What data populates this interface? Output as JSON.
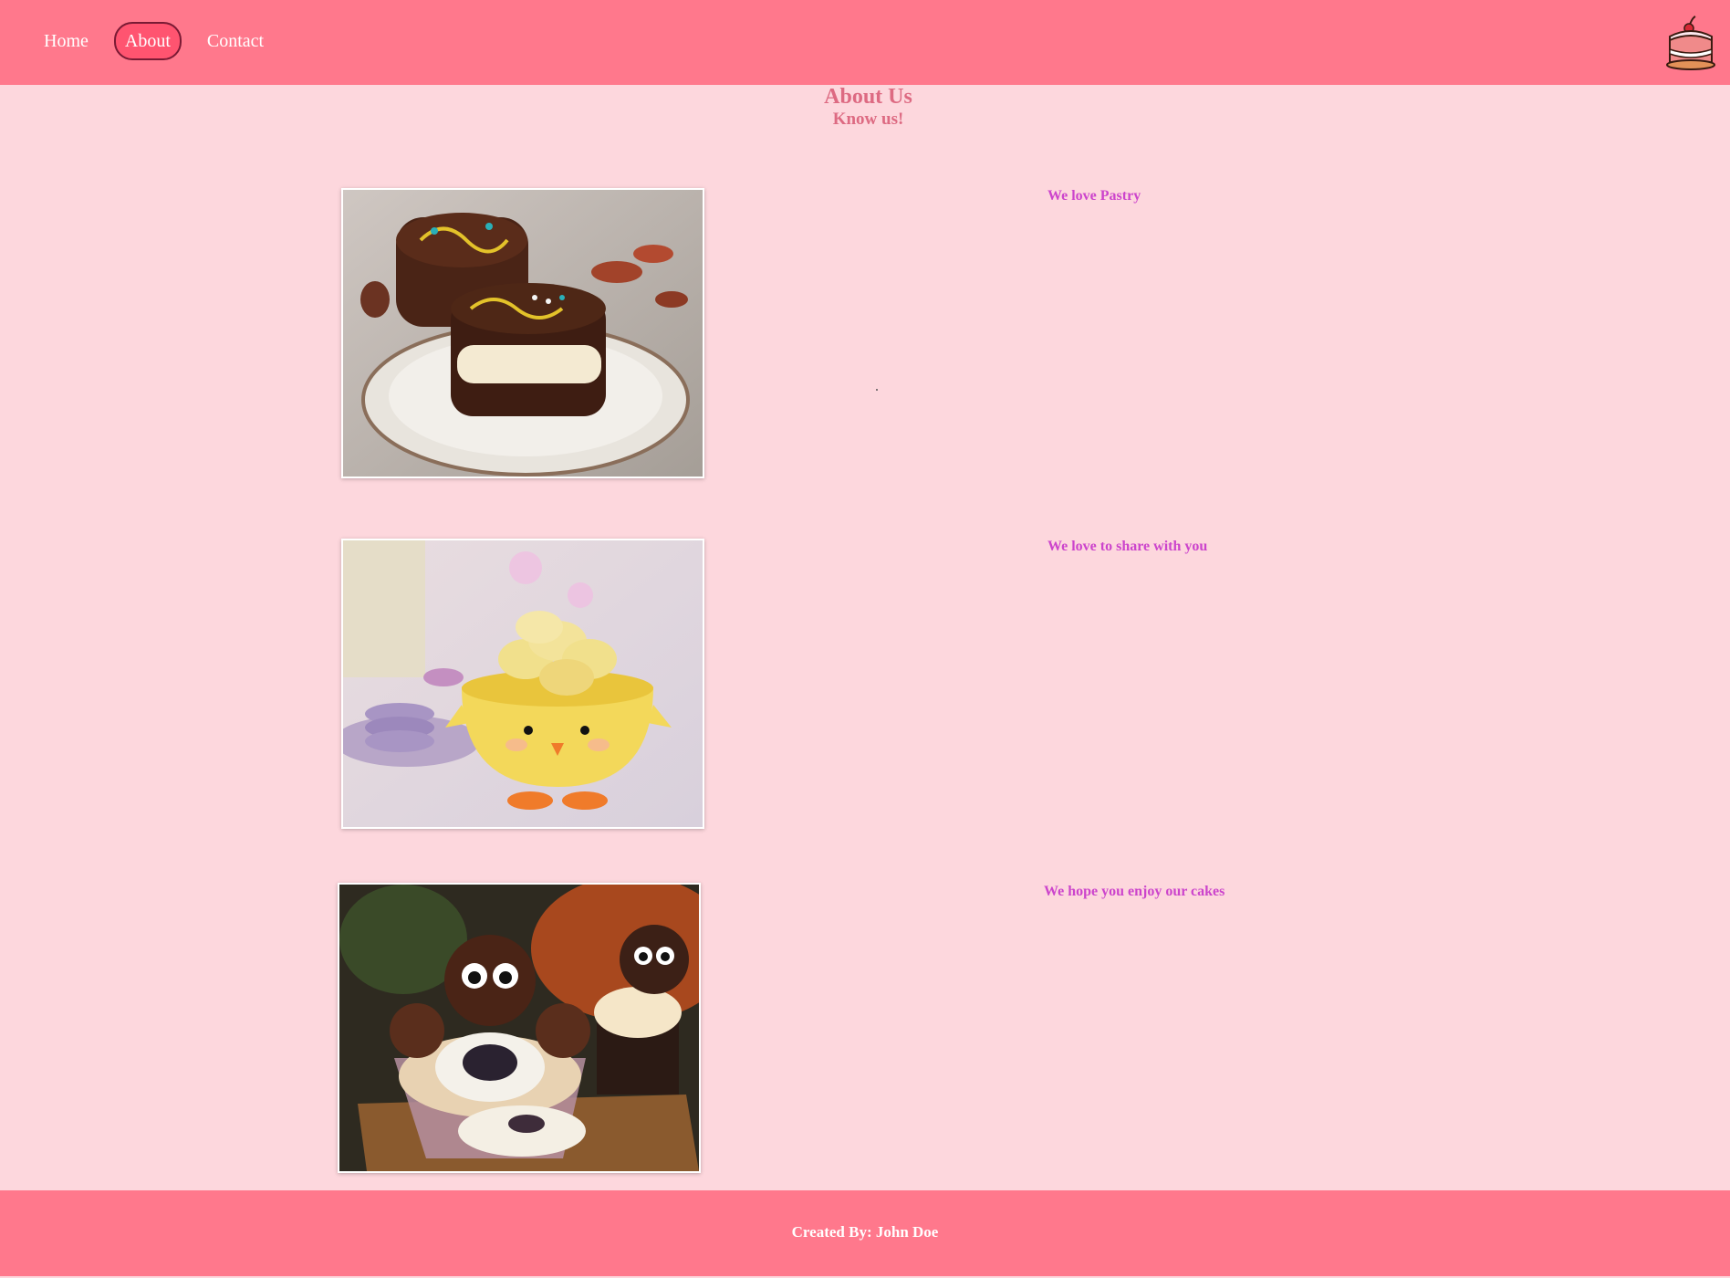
{
  "nav": {
    "items": [
      {
        "label": "Home",
        "active": false
      },
      {
        "label": "About",
        "active": true
      },
      {
        "label": "Contact",
        "active": false
      }
    ],
    "logo_icon": "cake-icon"
  },
  "header": {
    "title": "About Us",
    "subtitle": "Know us!"
  },
  "sections": [
    {
      "image": "chocolate-pastry-image",
      "caption": "We love Pastry"
    },
    {
      "image": "macaron-chick-bowl-image",
      "caption": "We love to share with you"
    },
    {
      "image": "oreo-cupcake-image",
      "caption": "We hope you enjoy our cakes"
    }
  ],
  "footer": {
    "text": "Created By: John Doe"
  },
  "colors": {
    "navbar": "#ff788c",
    "background": "#fdd7dd",
    "heading": "#dd6a82",
    "caption": "#cc44cc",
    "active_pill": "#ff5470"
  }
}
